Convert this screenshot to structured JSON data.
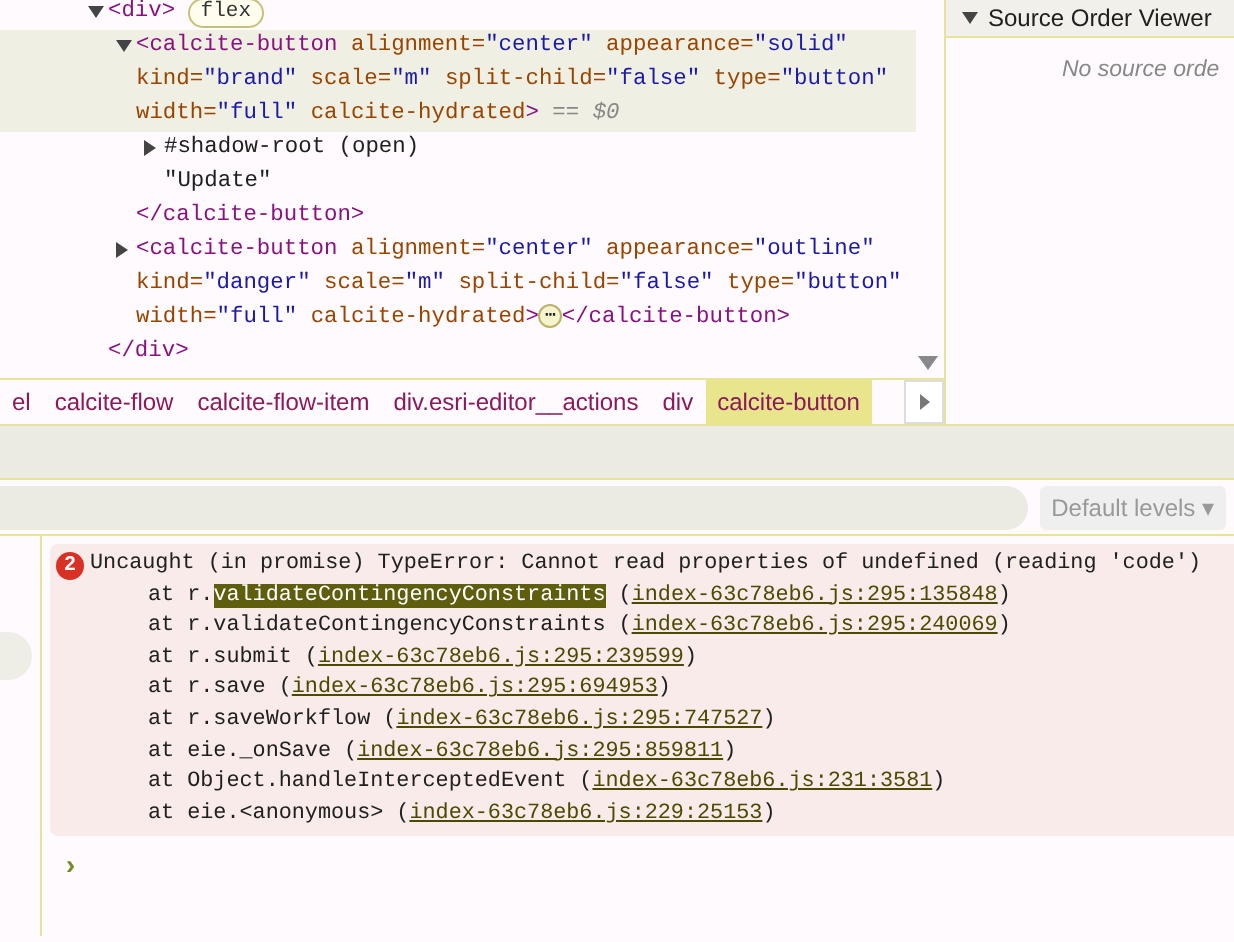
{
  "elements_tree": [
    {
      "tag": "<div",
      "end": ">",
      "badge": "flex",
      "expanded": true,
      "selected": false,
      "children": [
        {
          "tag": "<calcite-button",
          "end": ">",
          "expanded": true,
          "selected": true,
          "suffix": "== $0",
          "attributes": [
            {
              "name": "alignment=",
              "value": "\"center\""
            },
            {
              "name": "appearance=",
              "value": "\"solid\""
            },
            {
              "name": "kind=",
              "value": "\"brand\""
            },
            {
              "name": "scale=",
              "value": "\"m\""
            },
            {
              "name": "split-child=",
              "value": "\"false\""
            },
            {
              "name": "type=",
              "value": "\"button\""
            },
            {
              "name": "width=",
              "value": "\"full\""
            },
            {
              "name": "calcite-hydrated"
            }
          ],
          "children": [
            {
              "kind": "shadow-root",
              "text": "#shadow-root (open)",
              "expanded": false
            },
            {
              "kind": "text",
              "text": "\"Update\""
            }
          ],
          "closing": "</calcite-button>"
        },
        {
          "tag": "<calcite-button",
          "end": ">",
          "expanded": false,
          "selected": false,
          "ellipsis": "⋯",
          "attributes": [
            {
              "name": "alignment=",
              "value": "\"center\""
            },
            {
              "name": "appearance=",
              "value": "\"outline\""
            },
            {
              "name": "kind=",
              "value": "\"danger\""
            },
            {
              "name": "scale=",
              "value": "\"m\""
            },
            {
              "name": "split-child=",
              "value": "\"false\""
            },
            {
              "name": "type=",
              "value": "\"button\""
            },
            {
              "name": "width=",
              "value": "\"full\""
            },
            {
              "name": "calcite-hydrated"
            }
          ],
          "closing": "</calcite-button>"
        }
      ],
      "closing": "</div>"
    }
  ],
  "breadcrumbs": [
    {
      "label": "el",
      "selected": false
    },
    {
      "label": "calcite-flow",
      "selected": false
    },
    {
      "label": "calcite-flow-item",
      "selected": false
    },
    {
      "label": "div.esri-editor__actions",
      "selected": false
    },
    {
      "label": "div",
      "selected": false
    },
    {
      "label": "calcite-button",
      "selected": true
    }
  ],
  "source_order_viewer": {
    "title": "Source Order Viewer",
    "expanded": true,
    "message": "No source orde"
  },
  "console": {
    "levels_button": "Default levels ▾",
    "error": {
      "count": "2",
      "message": "Uncaught (in promise) TypeError: Cannot read properties of undefined (reading 'code')",
      "frames": [
        {
          "call": "at r.",
          "match": "validateContingencyConstraints",
          "rest": " (",
          "link": "index-63c78eb6.js:295:135848",
          "tail": ")"
        },
        {
          "call": "at r.validateContingencyConstraints (",
          "link": "index-63c78eb6.js:295:240069",
          "tail": ")"
        },
        {
          "call": "at r.submit (",
          "link": "index-63c78eb6.js:295:239599",
          "tail": ")"
        },
        {
          "call": "at r.save (",
          "link": "index-63c78eb6.js:295:694953",
          "tail": ")"
        },
        {
          "call": "at r.saveWorkflow (",
          "link": "index-63c78eb6.js:295:747527",
          "tail": ")"
        },
        {
          "call": "at eie._onSave (",
          "link": "index-63c78eb6.js:295:859811",
          "tail": ")"
        },
        {
          "call": "at Object.handleInterceptedEvent (",
          "link": "index-63c78eb6.js:231:3581",
          "tail": ")"
        },
        {
          "call": "at eie.<anonymous> (",
          "link": "index-63c78eb6.js:229:25153",
          "tail": ")"
        }
      ]
    },
    "prompt": "›"
  }
}
